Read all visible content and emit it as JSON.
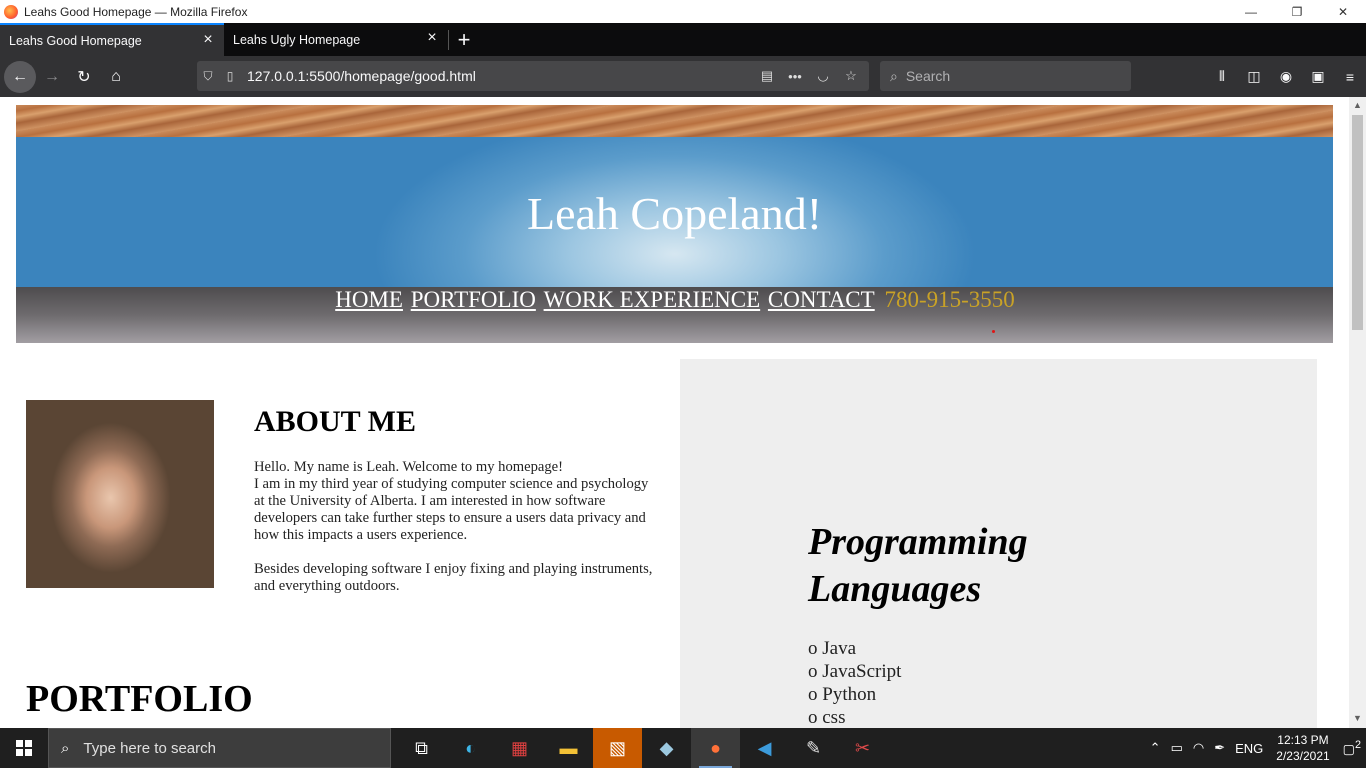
{
  "window": {
    "title": "Leahs Good Homepage — Mozilla Firefox",
    "controls": {
      "minimize": "—",
      "restore": "❐",
      "close": "✕"
    }
  },
  "tabs": [
    {
      "label": "Leahs Good Homepage",
      "active": true
    },
    {
      "label": "Leahs Ugly Homepage",
      "active": false
    }
  ],
  "newtab_label": "+",
  "navbar": {
    "url": "127.0.0.1:5500/homepage/good.html",
    "search_placeholder": "Search"
  },
  "page": {
    "name": "Leah Copeland!",
    "menu": [
      "HOME",
      "PORTFOLIO",
      "WORK EXPERIENCE",
      "CONTACT"
    ],
    "phone": "780-915-3550",
    "about_heading": "ABOUT ME",
    "about_p1_line1": "Hello. My name is Leah. Welcome to my homepage!",
    "about_p1_line2": "I am in my third year of studying computer science and psychology at the University of Alberta. I am interested in how software developers can take further steps to ensure a users data privacy and how this impacts a users experience.",
    "about_p2": "Besides developing software I enjoy fixing and playing instruments, and everything outdoors.",
    "portfolio_heading": "PORTFOLIO",
    "languages_heading": "Programming Languages",
    "languages": [
      "o Java",
      "o JavaScript",
      "o Python",
      "o css"
    ]
  },
  "taskbar": {
    "search_placeholder": "Type here to search",
    "language": "ENG",
    "time": "12:13 PM",
    "date": "2/23/2021",
    "notifications": "2"
  }
}
